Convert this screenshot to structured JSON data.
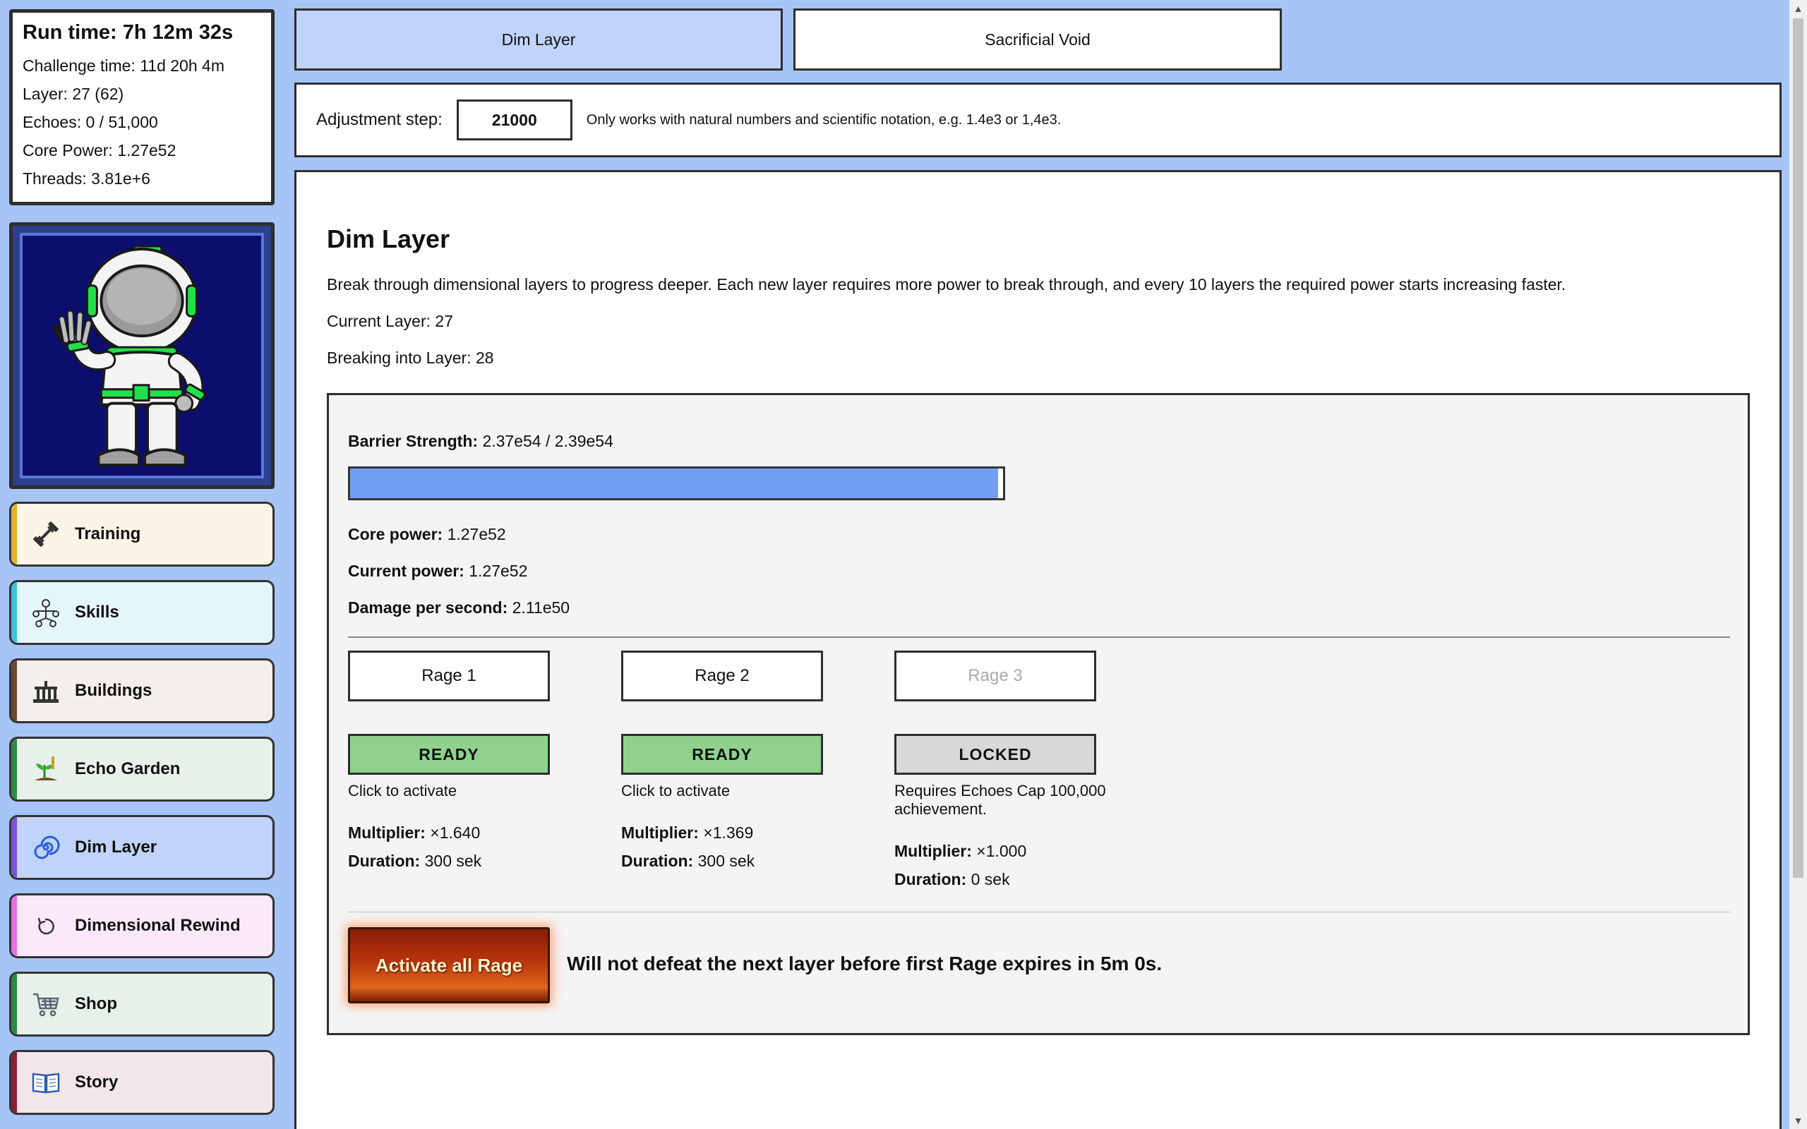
{
  "stats": {
    "run_time": "Run time: 7h 12m 32s",
    "challenge_time": "Challenge time: 11d 20h 4m",
    "layer": "Layer: 27 (62)",
    "echoes": "Echoes: 0 / 51,000",
    "core_power": "Core Power: 1.27e52",
    "threads": "Threads: 3.81e+6"
  },
  "sidebar": {
    "items": [
      {
        "label": "Training",
        "icon": "dumbbell-icon",
        "bg": "#fcf4e6",
        "stripe": "#e6b030"
      },
      {
        "label": "Skills",
        "icon": "skill-tree-icon",
        "bg": "#e4f6fb",
        "stripe": "#3fc2dc"
      },
      {
        "label": "Buildings",
        "icon": "building-icon",
        "bg": "#f3efeb",
        "stripe": "#6a4830"
      },
      {
        "label": "Echo Garden",
        "icon": "plant-icon",
        "bg": "#e7f1ea",
        "stripe": "#2f8a46"
      },
      {
        "label": "Dim Layer",
        "icon": "spiral-icon",
        "bg": "#bfd3fb",
        "stripe": "#7a52d8"
      },
      {
        "label": "Dimensional Rewind",
        "icon": "rewind-icon",
        "bg": "#fbe9fb",
        "stripe": "#e472e4"
      },
      {
        "label": "Shop",
        "icon": "cart-icon",
        "bg": "#e7f1ea",
        "stripe": "#2f8a46"
      },
      {
        "label": "Story",
        "icon": "book-icon",
        "bg": "#f3e6ea",
        "stripe": "#8a1e38"
      }
    ]
  },
  "tabs": {
    "dim_layer": "Dim Layer",
    "sacrificial_void": "Sacrificial Void"
  },
  "adjust": {
    "label": "Adjustment step:",
    "value": "21000",
    "hint": "Only works with natural numbers and scientific notation, e.g. 1.4e3 or 1,4e3."
  },
  "main": {
    "title": "Dim Layer",
    "description": "Break through dimensional layers to progress deeper. Each new layer requires more power to break through, and every 10 layers the required power starts increasing faster.",
    "current_layer": "Current Layer: 27",
    "breaking_into": "Breaking into Layer: 28"
  },
  "barrier": {
    "label": "Barrier Strength:",
    "value": "2.37e54 / 2.39e54",
    "progress": 0.992,
    "core_power_label": "Core power:",
    "core_power": "1.27e52",
    "current_power_label": "Current power:",
    "current_power": "1.27e52",
    "dps_label": "Damage per second:",
    "dps": "2.11e50"
  },
  "rage": [
    {
      "label": "Rage 1",
      "status": "READY",
      "note": "Click to activate",
      "multiplier_label": "Multiplier:",
      "multiplier": "×1.640",
      "duration_label": "Duration:",
      "duration": "300 sek"
    },
    {
      "label": "Rage 2",
      "status": "READY",
      "note": "Click to activate",
      "multiplier_label": "Multiplier:",
      "multiplier": "×1.369",
      "duration_label": "Duration:",
      "duration": "300 sek"
    },
    {
      "label": "Rage 3",
      "status": "LOCKED",
      "note": "Requires Echoes Cap 100,000 achievement.",
      "multiplier_label": "Multiplier:",
      "multiplier": "×1.000",
      "duration_label": "Duration:",
      "duration": "0 sek"
    }
  ],
  "activate_all": "Activate all Rage",
  "warning": "Will not defeat the next layer before first Rage expires in 5m 0s.",
  "colors": {
    "page_bg": "#a6c4f5",
    "active_tab": "#bfd3fb",
    "progress_fill": "#70a0f4",
    "ready": "#8fd18d",
    "locked": "#d8d8d8"
  }
}
